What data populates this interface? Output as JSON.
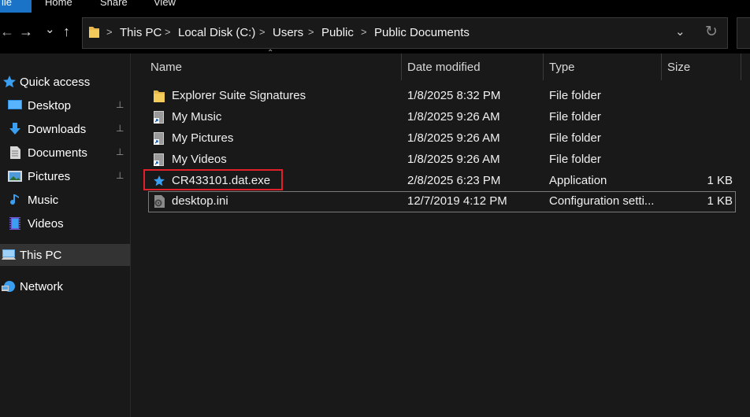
{
  "ribbon": {
    "tabs": [
      "ile",
      "Home",
      "Share",
      "View"
    ]
  },
  "nav": {
    "back_glyph": "←",
    "forward_glyph": "→",
    "recent_glyph": "⌄",
    "up_glyph": "↑"
  },
  "address": {
    "crumbs": [
      "This PC",
      "Local Disk (C:)",
      "Users",
      "Public",
      "Public Documents"
    ],
    "sep": ">",
    "dropdown_glyph": "⌄",
    "refresh_glyph": "↻"
  },
  "sidebar": {
    "items": [
      {
        "label": "Quick access",
        "icon": "star-icon",
        "pinned": false
      },
      {
        "label": "Desktop",
        "icon": "desktop-icon",
        "pinned": true
      },
      {
        "label": "Downloads",
        "icon": "download-arrow-icon",
        "pinned": true
      },
      {
        "label": "Documents",
        "icon": "document-icon",
        "pinned": true
      },
      {
        "label": "Pictures",
        "icon": "picture-icon",
        "pinned": true
      },
      {
        "label": "Music",
        "icon": "music-note-icon",
        "pinned": false
      },
      {
        "label": "Videos",
        "icon": "film-icon",
        "pinned": false
      },
      {
        "label": "This PC",
        "icon": "computer-icon",
        "pinned": false,
        "selected": true
      },
      {
        "label": "Network",
        "icon": "network-icon",
        "pinned": false
      }
    ],
    "pin_glyph": "📌"
  },
  "columns": {
    "name": "Name",
    "date": "Date modified",
    "type": "Type",
    "size": "Size",
    "sort_glyph": "⌃"
  },
  "files": [
    {
      "name": "Explorer Suite Signatures",
      "date": "1/8/2025 8:32 PM",
      "type": "File folder",
      "size": "",
      "icon": "folder-icon"
    },
    {
      "name": "My Music",
      "date": "1/8/2025 9:26 AM",
      "type": "File folder",
      "size": "",
      "icon": "shortcut-icon"
    },
    {
      "name": "My Pictures",
      "date": "1/8/2025 9:26 AM",
      "type": "File folder",
      "size": "",
      "icon": "shortcut-icon"
    },
    {
      "name": "My Videos",
      "date": "1/8/2025 9:26 AM",
      "type": "File folder",
      "size": "",
      "icon": "shortcut-icon"
    },
    {
      "name": "CR433101.dat.exe",
      "date": "2/8/2025 6:23 PM",
      "type": "Application",
      "size": "1 KB",
      "icon": "star-app-icon"
    },
    {
      "name": "desktop.ini",
      "date": "12/7/2019 4:12 PM",
      "type": "Configuration setti...",
      "size": "1 KB",
      "icon": "settings-file-icon"
    }
  ],
  "colors": {
    "accent": "#1a73c6",
    "highlight_box": "#e0202a",
    "background": "#191919"
  }
}
